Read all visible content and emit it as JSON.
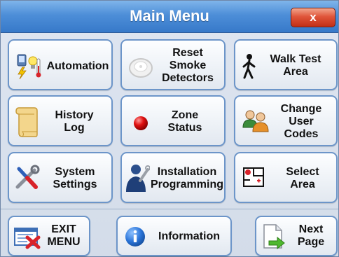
{
  "window": {
    "title": "Main Menu",
    "close_label": "x"
  },
  "buttons": [
    {
      "id": "automation",
      "label": "Automation"
    },
    {
      "id": "reset",
      "label": "Reset\nSmoke\nDetectors"
    },
    {
      "id": "walk",
      "label": "Walk Test\nArea"
    },
    {
      "id": "history",
      "label": "History\nLog"
    },
    {
      "id": "zone",
      "label": "Zone\nStatus"
    },
    {
      "id": "codes",
      "label": "Change\nUser\nCodes"
    },
    {
      "id": "system",
      "label": "System\nSettings"
    },
    {
      "id": "install",
      "label": "Installation\nProgramming"
    },
    {
      "id": "select",
      "label": "Select\nArea"
    }
  ],
  "footer": {
    "exit_label": "EXIT\nMENU",
    "info_label": "Information",
    "next_label": "Next\nPage"
  },
  "icons": {
    "automation": "automation-icon",
    "reset": "smoke-detector-icon",
    "walk": "walking-person-icon",
    "history": "scroll-icon",
    "zone": "red-status-light-icon",
    "codes": "users-icon",
    "system": "tools-icon",
    "install": "installer-person-icon",
    "select": "area-map-icon",
    "exit": "exit-menu-icon",
    "info": "info-icon",
    "next": "next-page-icon"
  }
}
